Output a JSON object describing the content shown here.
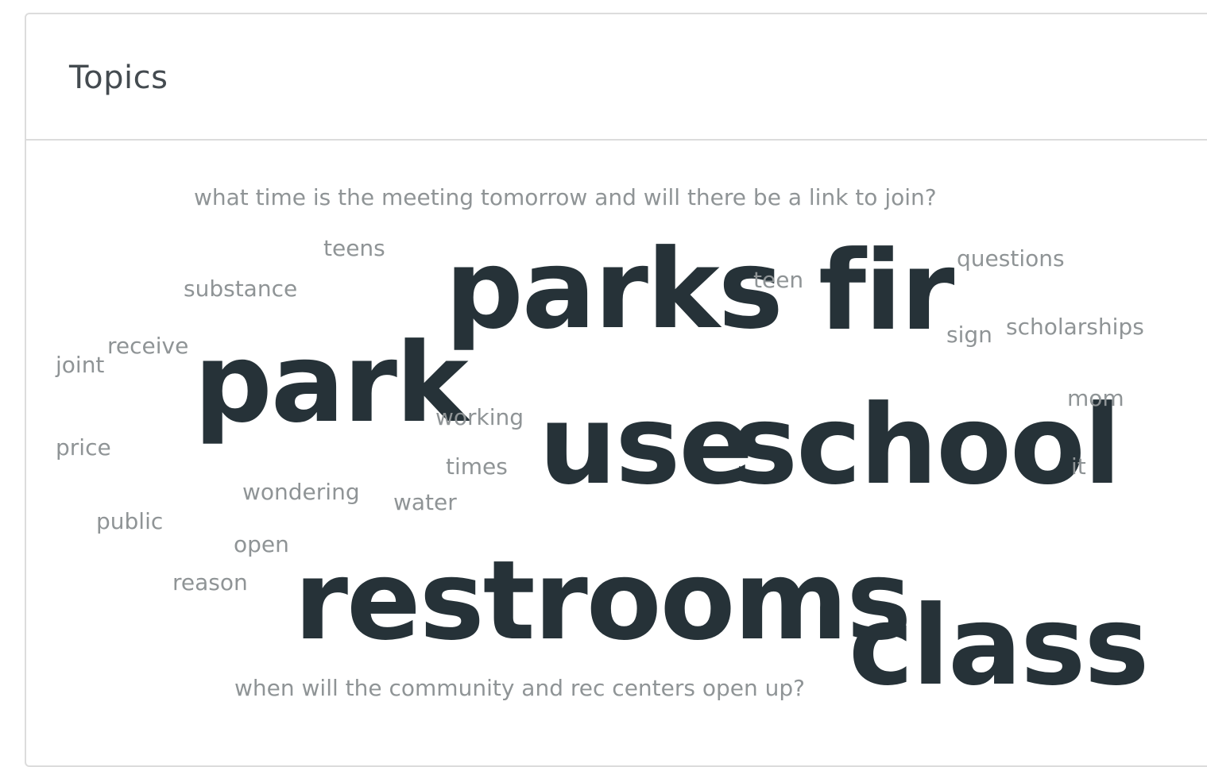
{
  "panel": {
    "title": "Topics"
  },
  "word_cloud": {
    "words": [
      {
        "text": "what time is the meeting tomorrow and will there be a link to join?"
      },
      {
        "text": "teens"
      },
      {
        "text": "substance"
      },
      {
        "text": "parks"
      },
      {
        "text": "teen"
      },
      {
        "text": "fir"
      },
      {
        "text": "questions"
      },
      {
        "text": "sign"
      },
      {
        "text": "scholarships"
      },
      {
        "text": "receive"
      },
      {
        "text": "joint"
      },
      {
        "text": "park"
      },
      {
        "text": "working"
      },
      {
        "text": "use"
      },
      {
        "text": "school"
      },
      {
        "text": "mom"
      },
      {
        "text": "price"
      },
      {
        "text": "times"
      },
      {
        "text": "it"
      },
      {
        "text": "wondering"
      },
      {
        "text": "water"
      },
      {
        "text": "public"
      },
      {
        "text": "open"
      },
      {
        "text": "reason"
      },
      {
        "text": "restrooms"
      },
      {
        "text": "class"
      },
      {
        "text": "when will the community and rec centers open up?"
      }
    ]
  }
}
